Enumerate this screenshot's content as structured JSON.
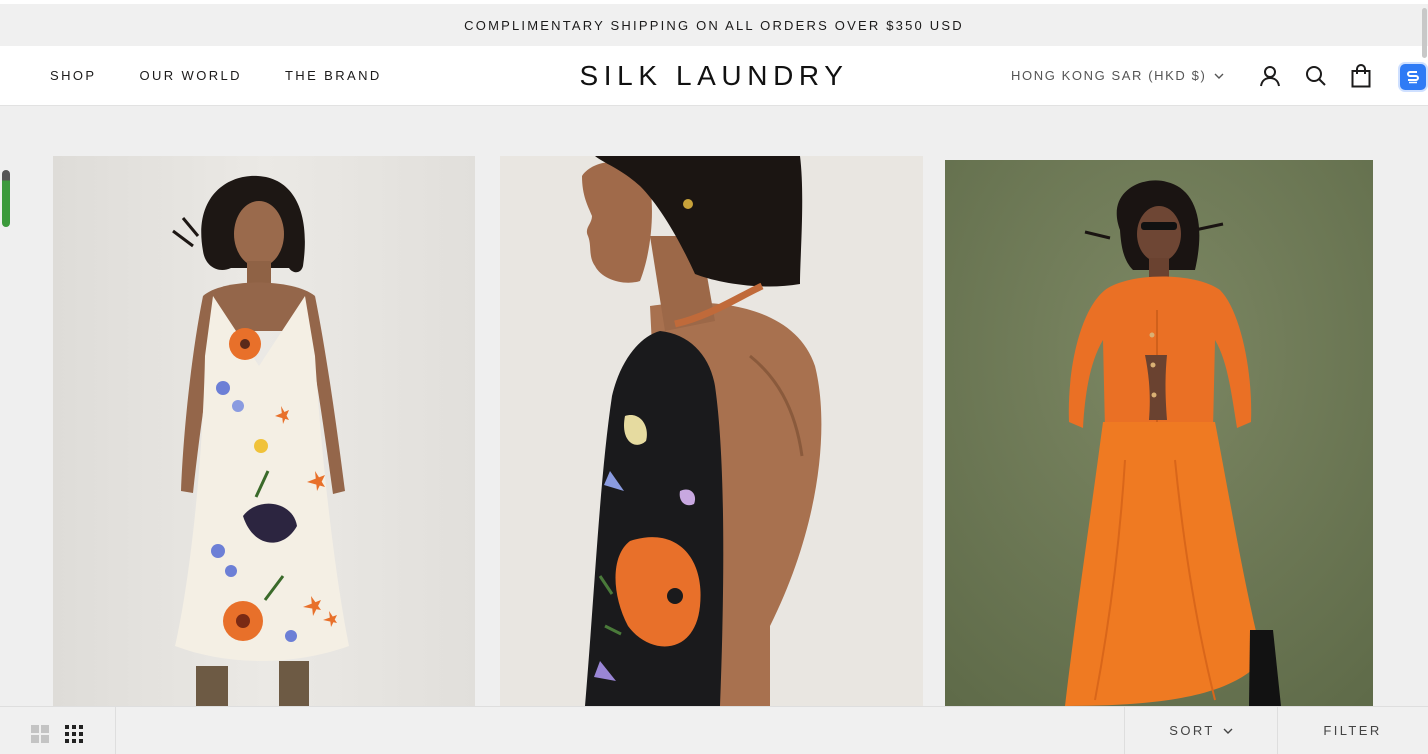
{
  "announcement": "COMPLIMENTARY SHIPPING ON ALL ORDERS OVER $350 USD",
  "nav": {
    "shop": "SHOP",
    "our_world": "OUR WORLD",
    "the_brand": "THE BRAND"
  },
  "brand": {
    "logo": "SILK LAUNDRY"
  },
  "header": {
    "locale": "HONG KONG SAR (HKD $)",
    "icons": [
      "account-icon",
      "search-icon",
      "cart-icon",
      "extension-icon"
    ]
  },
  "products": [
    {
      "image": "woman in white floral silk slip dress",
      "background": "#e7e5e1"
    },
    {
      "image": "woman in black floral halter dress, side profile",
      "background": "#e9e6e1"
    },
    {
      "image": "woman in orange knit cardigan and skirt",
      "background": "#6f7a58"
    }
  ],
  "toolbar": {
    "sort": "SORT",
    "filter": "FILTER",
    "view_icons": [
      "grid-2-icon",
      "grid-4-icon"
    ]
  },
  "colors": {
    "accent_orange": "#e8702a",
    "text": "#1c1b1b",
    "ext_blue": "#2f7bf5"
  }
}
